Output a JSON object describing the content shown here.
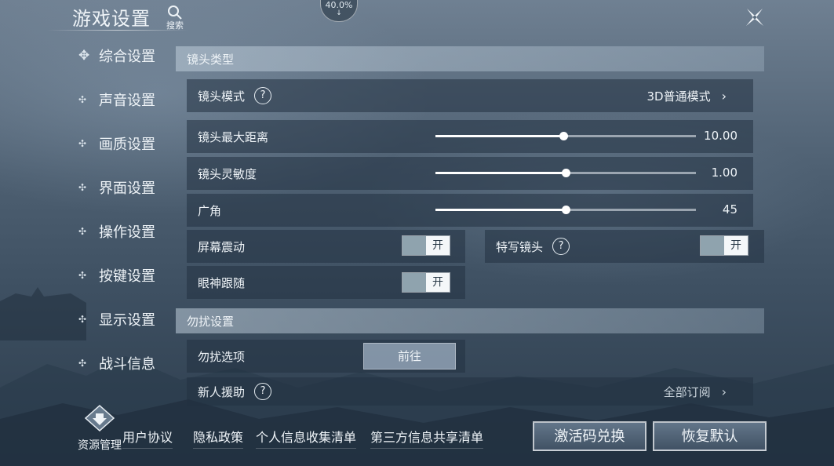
{
  "header": {
    "title": "游戏设置",
    "search_label": "搜索",
    "progress_text": "40.0%",
    "download_glyph": "↓"
  },
  "colors": {
    "accent_white": "#ffffff",
    "toggle_on": "#f4f7f9",
    "toggle_off": "#8fa3ae",
    "panel": "#223242"
  },
  "icons": {
    "close": "close-icon",
    "search": "search-icon",
    "help": "question-icon"
  },
  "nav": {
    "marker_active": "✥",
    "marker": "✣",
    "items": [
      {
        "label": "综合设置",
        "active": true
      },
      {
        "label": "声音设置"
      },
      {
        "label": "画质设置"
      },
      {
        "label": "界面设置"
      },
      {
        "label": "操作设置"
      },
      {
        "label": "按键设置"
      },
      {
        "label": "显示设置"
      },
      {
        "label": "战斗信息"
      }
    ]
  },
  "camera": {
    "section_title": "镜头类型",
    "mode_label": "镜头模式",
    "mode_value": "3D普通模式",
    "help": "?",
    "chevron": "›",
    "sliders": [
      {
        "label": "镜头最大距离",
        "value": "10.00",
        "fraction": 0.49
      },
      {
        "label": "镜头灵敏度",
        "value": "1.00",
        "fraction": 0.5
      },
      {
        "label": "广角",
        "value": "45",
        "fraction": 0.5
      }
    ],
    "shake_label": "屏幕震动",
    "closeup_label": "特写镜头",
    "gaze_label": "眼神跟随",
    "toggle_on_text": "开"
  },
  "dnd": {
    "section_title": "勿扰设置",
    "options_label": "勿扰选项",
    "goto_label": "前往",
    "newbie_label": "新人援助",
    "newbie_value": "全部订阅"
  },
  "footer": {
    "resource_label": "资源管理",
    "links": [
      "用户协议",
      "隐私政策",
      "个人信息收集清单",
      "第三方信息共享清单"
    ],
    "redeem_button": "激活码兑换",
    "reset_button": "恢复默认"
  }
}
